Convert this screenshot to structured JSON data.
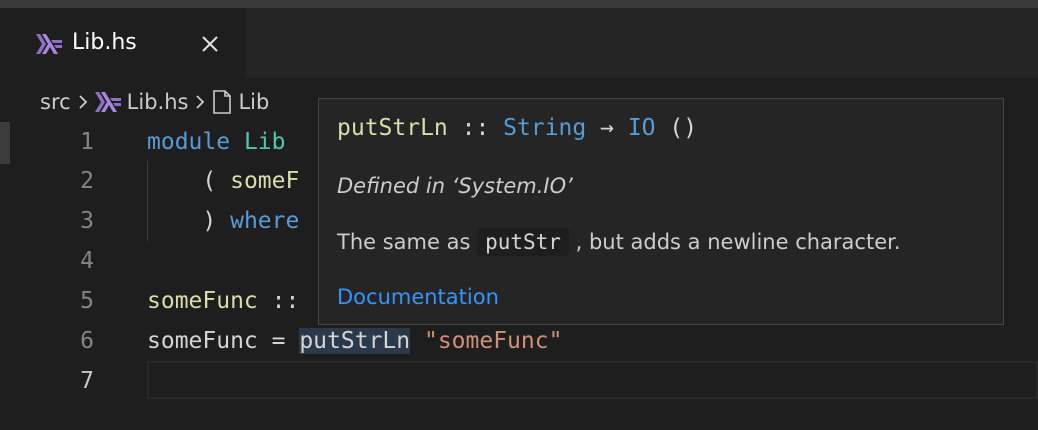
{
  "tab": {
    "label": "Lib.hs",
    "icon": "haskell-icon",
    "close_icon": "close-icon"
  },
  "breadcrumb": {
    "items": [
      {
        "label": "src",
        "icon": ""
      },
      {
        "label": "Lib.hs",
        "icon": "haskell-icon"
      },
      {
        "label": "Lib",
        "icon": "file-icon"
      }
    ]
  },
  "editor": {
    "active_line": "7",
    "lines": [
      {
        "n": "1",
        "tokens": [
          {
            "t": "module",
            "c": "kw"
          },
          {
            "t": " ",
            "c": "pl"
          },
          {
            "t": "Lib",
            "c": "ty"
          }
        ]
      },
      {
        "n": "2",
        "tokens": [
          {
            "t": "    ( ",
            "c": "pl"
          },
          {
            "t": "someF",
            "c": "fn"
          }
        ]
      },
      {
        "n": "3",
        "tokens": [
          {
            "t": "    ) ",
            "c": "pl"
          },
          {
            "t": "where",
            "c": "kw"
          }
        ]
      },
      {
        "n": "4",
        "tokens": []
      },
      {
        "n": "5",
        "tokens": [
          {
            "t": "someFunc",
            "c": "fn"
          },
          {
            "t": " ::",
            "c": "pl"
          }
        ]
      },
      {
        "n": "6",
        "tokens": [
          {
            "t": "someFunc = ",
            "c": "pl"
          },
          {
            "t": "putStrLn",
            "c": "pl hl2"
          },
          {
            "t": " ",
            "c": "pl"
          },
          {
            "t": "\"someFunc\"",
            "c": "str"
          }
        ]
      },
      {
        "n": "7",
        "tokens": []
      }
    ]
  },
  "hover": {
    "signature": [
      {
        "t": "putStrLn",
        "c": "fn"
      },
      {
        "t": " :: ",
        "c": "pl"
      },
      {
        "t": "String",
        "c": "kw"
      },
      {
        "t": " → ",
        "c": "pl"
      },
      {
        "t": "IO",
        "c": "kw"
      },
      {
        "t": " ()",
        "c": "pl"
      }
    ],
    "defined_in": "Defined in ‘System.IO’",
    "desc_before": "The same as ",
    "desc_code": "putStr",
    "desc_after": " , but adds a newline character.",
    "doc_link": "Documentation"
  },
  "colors": {
    "keyword": "#569cd6",
    "type": "#4ec9b0",
    "function": "#dcdcaa",
    "string": "#ce9178",
    "link": "#3794ff",
    "background": "#1e1e1e"
  }
}
